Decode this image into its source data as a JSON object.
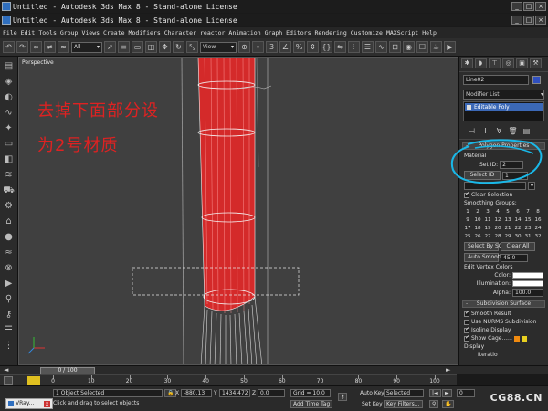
{
  "window": {
    "title_back": "Untitled - Autodesk 3ds Max 8  - Stand-alone License",
    "title_front": "Untitled - Autodesk 3ds Max 8  - Stand-alone License"
  },
  "menu": [
    "File",
    "Edit",
    "Tools",
    "Group",
    "Views",
    "Create",
    "Modifiers",
    "Character",
    "reactor",
    "Animation",
    "Graph Editors",
    "Rendering",
    "Customize",
    "MAXScript",
    "Help"
  ],
  "toolbar": {
    "selection_filter": "All",
    "coord_system": "View"
  },
  "viewport": {
    "label": "Perspective",
    "annotation_line1": "去掉下面部分设",
    "annotation_line2": "为2号材质"
  },
  "command_panel": {
    "object_name": "Line02",
    "modifier_list": "Modifier List",
    "stack_item": "Editable Poly",
    "rollout_polygon_props": "Polygon Properties",
    "material_label": "Material",
    "set_id_label": "Set ID:",
    "set_id_value": "2",
    "select_id_button": "Select ID",
    "select_id_value": "1",
    "clear_selection": "Clear Selection",
    "smoothing_groups_label": "Smoothing Groups:",
    "smoothing_groups": [
      "1",
      "2",
      "3",
      "4",
      "5",
      "6",
      "7",
      "8",
      "9",
      "10",
      "11",
      "12",
      "13",
      "14",
      "15",
      "16",
      "17",
      "18",
      "19",
      "20",
      "21",
      "22",
      "23",
      "24",
      "25",
      "26",
      "27",
      "28",
      "29",
      "30",
      "31",
      "32"
    ],
    "select_by_sg": "Select By SG",
    "clear_all": "Clear All",
    "auto_smooth": "Auto Smooth",
    "auto_smooth_value": "45.0",
    "edit_vertex_colors": "Edit Vertex Colors",
    "color_label": "Color:",
    "illumination_label": "Illumination:",
    "alpha_label": "Alpha:",
    "alpha_value": "100.0",
    "rollout_subdivision": "Subdivision Surface",
    "smooth_result": "Smooth Result",
    "use_nurms": "Use NURMS Subdivision",
    "isoline_display": "Isoline Display",
    "show_cage": "Show Cage......",
    "display_label": "Display",
    "iterations_label": "Iteratio"
  },
  "timeline": {
    "slider_label": "0 / 100",
    "ticks": [
      "0",
      "10",
      "20",
      "30",
      "40",
      "50",
      "60",
      "70",
      "80",
      "90",
      "100"
    ]
  },
  "status": {
    "selection_info": "1 Object Selected",
    "prompt": "Click and drag to select objects",
    "x_label": "X",
    "x_value": "-880.13",
    "y_label": "Y",
    "y_value": "1434.472",
    "z_label": "Z",
    "z_value": "0.0",
    "grid": "Grid = 10.0",
    "add_time_tag": "Add Time Tag",
    "auto_key": "Auto Key",
    "set_key": "Set Key",
    "key_mode": "Selected",
    "key_filters": "Key Filters...",
    "frame_value": "0",
    "taskbar_item": "VRay..."
  },
  "watermark": "CG88.CN",
  "colors": {
    "tube_red": "#d42a2a",
    "annotation_red": "#dd2222",
    "highlight_blue": "#3b68b6",
    "scribble_cyan": "#19b8e8"
  }
}
